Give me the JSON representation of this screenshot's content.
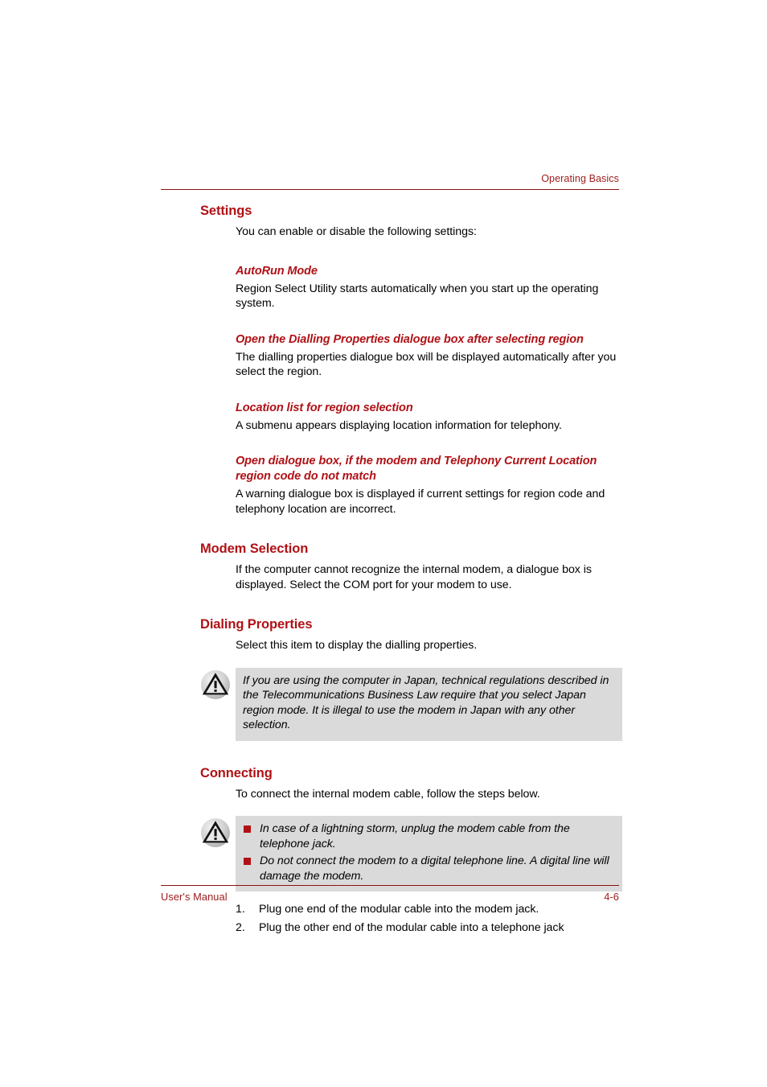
{
  "header": {
    "running_head": "Operating Basics"
  },
  "colors": {
    "heading_red": "#b01116",
    "rule_red": "#8e1111",
    "footer_red": "#9e1a1a",
    "notice_background": "#dadada",
    "bullet_red": "#b01116",
    "body_text": "#000000"
  },
  "sections": {
    "settings": {
      "heading": "Settings",
      "intro": "You can enable or disable the following settings:",
      "subsections": [
        {
          "heading": "AutoRun Mode",
          "body": "Region Select Utility starts automatically when you start up the operating system."
        },
        {
          "heading": "Open the Dialling Properties dialogue box after selecting region",
          "body": "The dialling properties dialogue box will be displayed automatically after you select the region."
        },
        {
          "heading": "Location list for region selection",
          "body": "A submenu appears displaying location information for telephony."
        },
        {
          "heading": "Open dialogue box, if the modem and Telephony Current Location region code do not match",
          "body": "A warning dialogue box is displayed if current settings for region code and telephony location are incorrect."
        }
      ]
    },
    "modem_selection": {
      "heading": "Modem Selection",
      "body": "If the computer cannot recognize the internal modem, a dialogue box is displayed. Select the COM port for your modem to use."
    },
    "dialing_properties": {
      "heading": "Dialing Properties",
      "body": "Select this item to display the dialling properties.",
      "notice": {
        "icon": "warning-triangle-icon",
        "text": "If you are using the computer in Japan, technical regulations described in the Telecommunications Business Law require that you select Japan region mode. It is illegal to use the modem in Japan with any other selection."
      }
    },
    "connecting": {
      "heading": "Connecting",
      "body": "To connect the internal modem cable, follow the steps below.",
      "notice": {
        "icon": "warning-triangle-icon",
        "items": [
          "In case of a lightning storm, unplug the modem cable from the telephone jack.",
          "Do not connect the modem to a digital telephone line. A digital line will damage the modem."
        ]
      },
      "steps": [
        {
          "num": "1.",
          "text": "Plug one end of the modular cable into the modem jack."
        },
        {
          "num": "2.",
          "text": "Plug the other end of the modular cable into a telephone jack"
        }
      ]
    }
  },
  "footer": {
    "left": "User's Manual",
    "right": "4-6"
  }
}
